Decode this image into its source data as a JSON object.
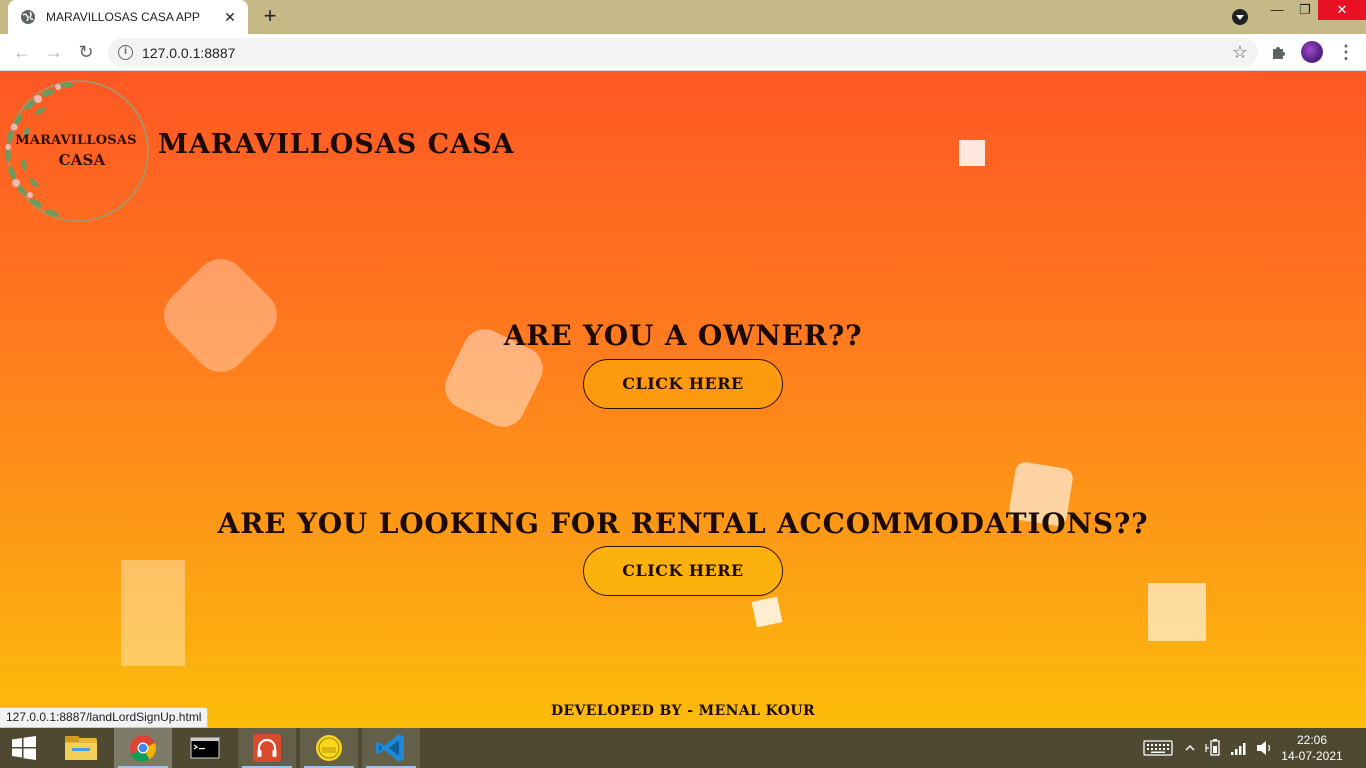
{
  "browser": {
    "tab_title": "MARAVILLOSAS CASA APP",
    "url": "127.0.0.1:8887",
    "status_link": "127.0.0.1:8887/landLordSignUp.html"
  },
  "logo": {
    "line1": "MARAVILLOSAS",
    "line2": "CASA"
  },
  "header": {
    "brand": "MARAVILLOSAS CASA"
  },
  "sections": [
    {
      "question": "ARE YOU A OWNER??",
      "button": "CLICK HERE"
    },
    {
      "question": "ARE YOU LOOKING FOR RENTAL ACCOMMODATIONS??",
      "button": "CLICK HERE"
    }
  ],
  "footer": {
    "credit": "DEVELOPED BY - MENAL KOUR"
  },
  "taskbar": {
    "time": "22:06",
    "date": "14-07-2021",
    "apps": [
      "file-explorer",
      "chrome",
      "command-prompt",
      "headphones-app",
      "sticker-app",
      "vscode"
    ]
  },
  "colors": {
    "gradient_top": "#ff5724",
    "gradient_bottom": "#fcbd0a",
    "text_dark": "#1c0a04",
    "taskbar": "#4e4930",
    "tabstrip": "#c5b987"
  }
}
